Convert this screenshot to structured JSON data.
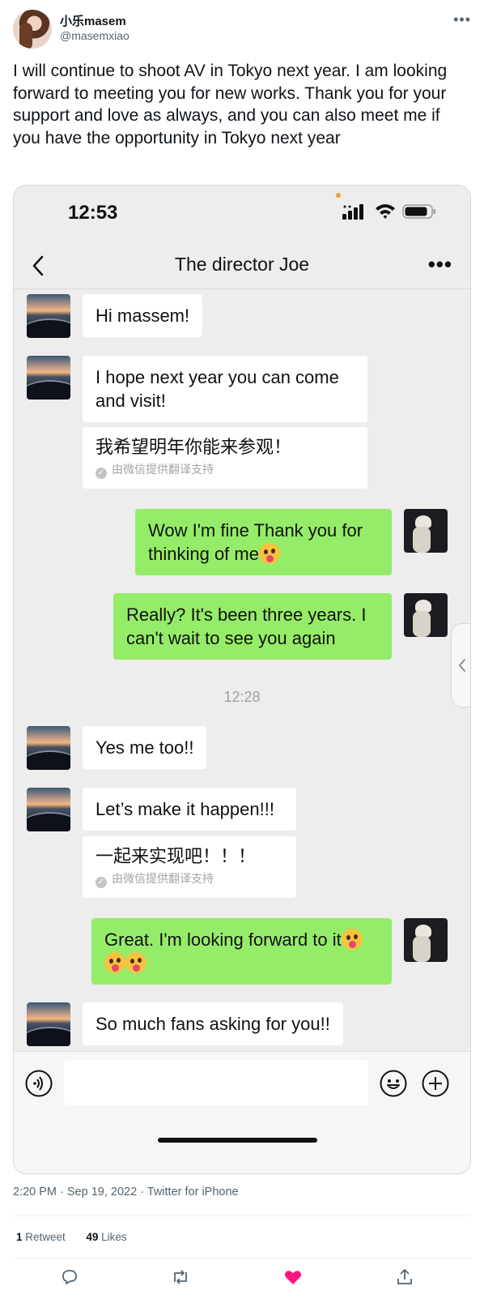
{
  "tweet": {
    "display_name": "小乐masem",
    "handle": "@masemxiao",
    "text": "I will continue to shoot AV in Tokyo next year. I am looking forward to meeting you for new works. Thank you for your support and love as always, and you can also meet me if you have the opportunity in Tokyo next year",
    "meta": "2:20 PM · Sep 19, 2022 · Twitter for iPhone",
    "retweets": "1",
    "retweets_label": "Retweet",
    "likes": "49",
    "likes_label": "Likes"
  },
  "phone": {
    "time": "12:53",
    "chat_title": "The director Joe"
  },
  "messages": [
    {
      "side": "left",
      "text": "Hi massem!"
    },
    {
      "side": "left",
      "text": "I hope next year you can come and visit!",
      "translation": "我希望明年你能来参观！",
      "translation_note": "由微信提供翻译支持"
    },
    {
      "side": "right",
      "text": "Wow I'm fine Thank you for thinking of me"
    },
    {
      "side": "right",
      "text": "Really? It's been three years. I can't wait to see you again"
    },
    {
      "side": "left",
      "text": "Yes me too!!"
    },
    {
      "side": "left",
      "text": "Let’s make it happen!!!",
      "translation": "一起来实现吧！！！",
      "translation_note": "由微信提供翻译支持"
    },
    {
      "side": "right",
      "text": "Great. I'm looking forward to it"
    },
    {
      "side": "left",
      "text": "So much fans asking for you!!"
    }
  ],
  "time_divider": "12:28",
  "colors": {
    "green_bubble": "#95ec69",
    "chat_bg": "#ededed",
    "like_pink": "#f91880"
  },
  "icons": {
    "more": "more-horizontal-icon",
    "back": "chevron-left-icon",
    "voice": "voice-icon",
    "emoji": "smiley-icon",
    "plus": "plus-circle-icon",
    "reply": "reply-icon",
    "retweet": "retweet-icon",
    "like": "heart-icon",
    "share": "share-icon"
  }
}
